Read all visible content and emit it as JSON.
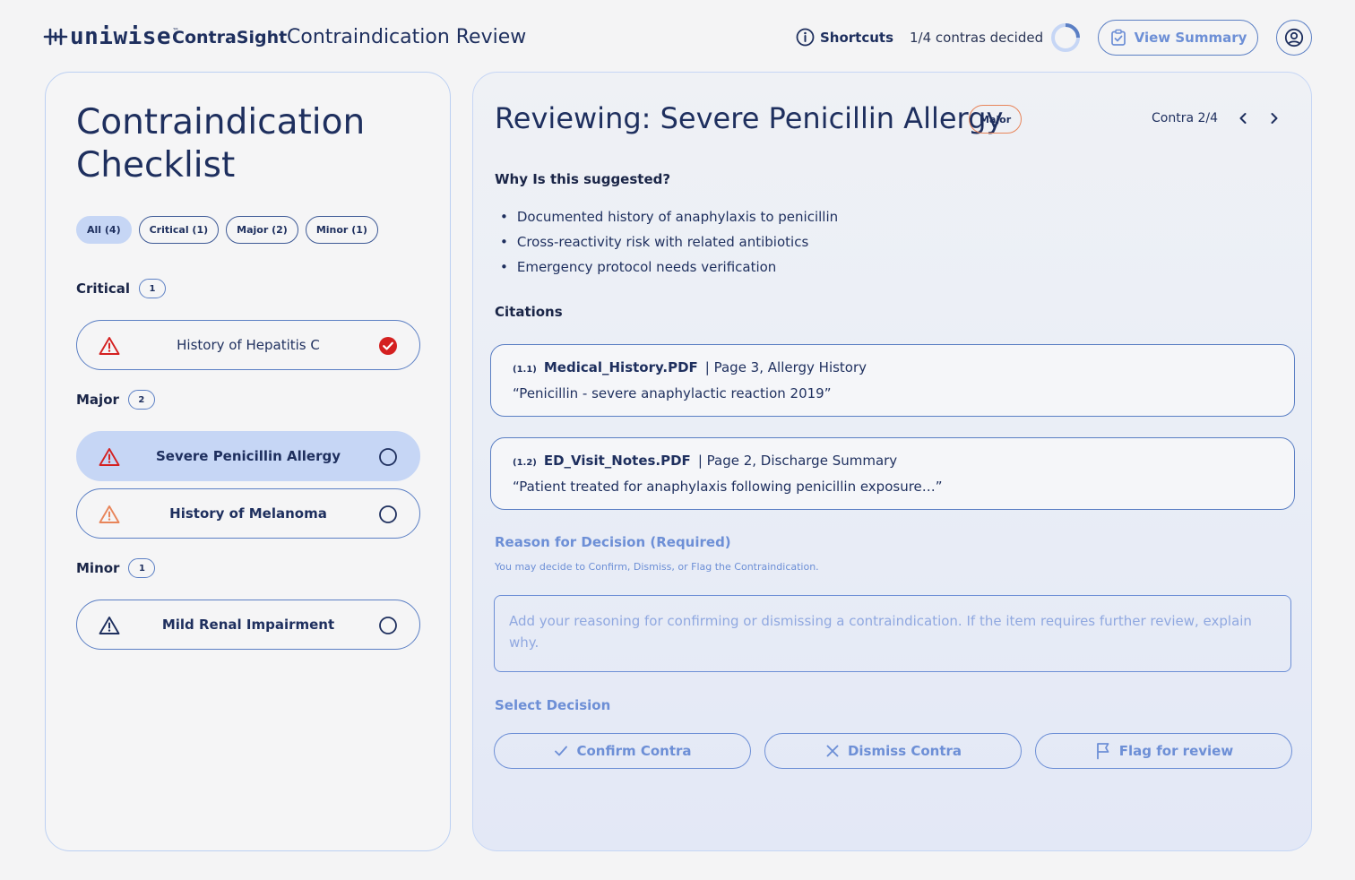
{
  "header": {
    "logo_text": "uniwise",
    "logo_tm": "™",
    "product_name": "ContraSight",
    "page_name": "Contraindication Review",
    "shortcuts_label": "Shortcuts",
    "progress_text": "1/4 contras decided",
    "progress_fraction": 0.25,
    "view_summary_label": "View Summary"
  },
  "checklist": {
    "title": "Contraindication Checklist",
    "filters": [
      {
        "label": "All (4)",
        "active": true
      },
      {
        "label": "Critical (1)",
        "active": false
      },
      {
        "label": "Major (2)",
        "active": false
      },
      {
        "label": "Minor (1)",
        "active": false
      }
    ],
    "groups": [
      {
        "name": "Critical",
        "count": "1"
      },
      {
        "name": "Major",
        "count": "2"
      },
      {
        "name": "Minor",
        "count": "1"
      }
    ],
    "items": [
      {
        "label": "History of Hepatitis C",
        "severity": "critical",
        "status": "decided",
        "selected": false
      },
      {
        "label": "Severe Penicillin Allergy",
        "severity": "critical",
        "status": "pending",
        "selected": true
      },
      {
        "label": "History of Melanoma",
        "severity": "major",
        "status": "pending",
        "selected": false
      },
      {
        "label": "Mild Renal Impairment",
        "severity": "minor",
        "status": "pending",
        "selected": false
      }
    ]
  },
  "review": {
    "title": "Reviewing: Severe Penicillin Allergy",
    "severity_badge": "Major",
    "position": "Contra 2/4",
    "why_heading": "Why Is this suggested?",
    "reasons": [
      "Documented history of anaphylaxis to penicillin",
      "Cross-reactivity risk with related antibiotics",
      "Emergency protocol needs verification"
    ],
    "citations_heading": "Citations",
    "citations": [
      {
        "index": "(1.1)",
        "file": "Medical_History.PDF",
        "location": "| Page 3, Allergy History",
        "quote": "“Penicillin - severe anaphylactic reaction 2019”"
      },
      {
        "index": "(1.2)",
        "file": "ED_Visit_Notes.PDF",
        "location": "| Page 2, Discharge Summary",
        "quote": "“Patient treated for anaphylaxis following penicillin exposure…”"
      }
    ],
    "reason_label": "Reason for Decision (Required)",
    "reason_help": "You may decide to Confirm, Dismiss, or Flag the Contraindication.",
    "reason_placeholder": "Add your reasoning for confirming or dismissing a contraindication. If the item requires further review, explain why.",
    "reason_value": "",
    "decision_label": "Select Decision",
    "decisions": {
      "confirm": "Confirm Contra",
      "dismiss": "Dismiss Contra",
      "flag": "Flag for review"
    }
  },
  "colors": {
    "navy": "#1e2f5e",
    "accent": "#5b7fc4",
    "accent_light": "#6d8fd6",
    "selected_bg": "#c6d6f5",
    "critical": "#d42020",
    "major": "#e8855a"
  },
  "icons": {
    "shortcuts": "info-icon",
    "view_summary": "clipboard-check-icon",
    "profile": "user-circle-icon",
    "severity": "warning-triangle-icon",
    "decided": "check-circle-icon",
    "pending": "empty-circle-icon",
    "confirm": "check-icon",
    "dismiss": "x-icon",
    "flag": "flag-icon"
  }
}
